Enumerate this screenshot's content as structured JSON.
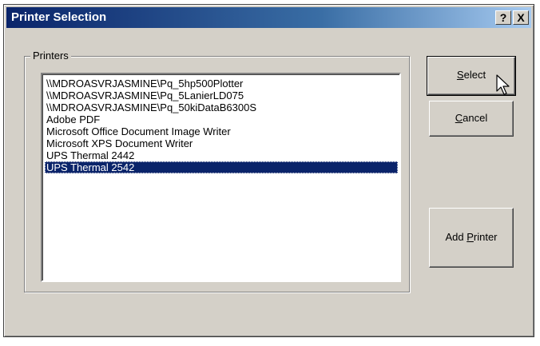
{
  "window": {
    "title": "Printer Selection",
    "help_button": "?",
    "close_button": "X"
  },
  "printers": {
    "label": "Printers",
    "items": [
      "\\\\MDROASVRJASMINE\\Pq_5hp500Plotter",
      "\\\\MDROASVRJASMINE\\Pq_5LanierLD075",
      "\\\\MDROASVRJASMINE\\Pq_50kiDataB6300S",
      "Adobe PDF",
      "Microsoft Office Document Image Writer",
      "Microsoft XPS Document Writer",
      "UPS Thermal 2442",
      "UPS Thermal 2542"
    ],
    "selected_item": "UPS Thermal 2542"
  },
  "buttons": {
    "select": {
      "accel": "S",
      "rest": "elect"
    },
    "cancel": {
      "accel": "C",
      "rest": "ancel"
    },
    "add_printer": {
      "pre": "Add ",
      "accel": "P",
      "rest": "rinter"
    }
  },
  "icons": {
    "cursor": "arrow-pointer-icon"
  },
  "colors": {
    "titlebar_start": "#0a246a",
    "titlebar_end": "#a6caf0",
    "selection": "#0a246a",
    "dialog_face": "#d4d0c8"
  }
}
